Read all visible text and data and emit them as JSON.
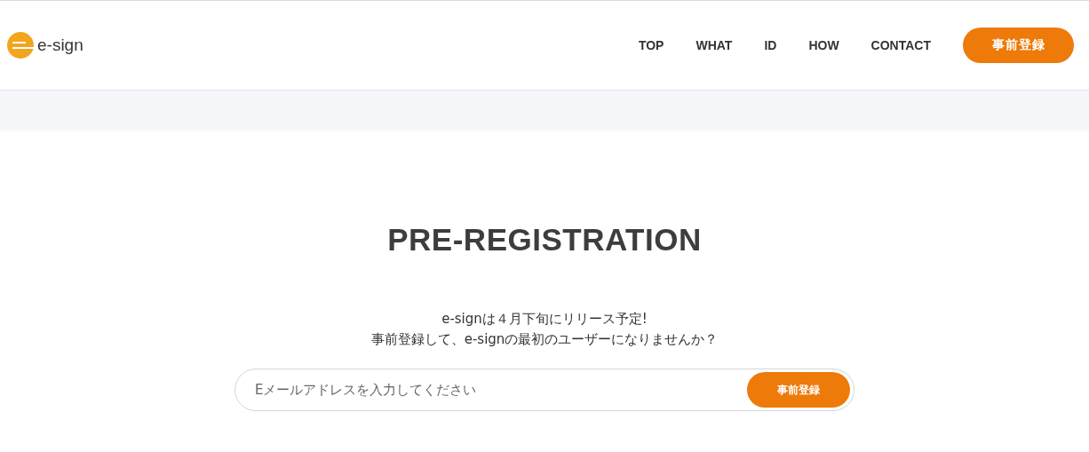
{
  "header": {
    "logo": "e-sign",
    "nav": [
      {
        "label": "TOP"
      },
      {
        "label": "WHAT"
      },
      {
        "label": "ID"
      },
      {
        "label": "HOW"
      },
      {
        "label": "CONTACT"
      }
    ],
    "cta": "事前登録"
  },
  "main": {
    "title": "PRE-REGISTRATION",
    "lines": [
      "e-signは４月下旬にリリース予定!",
      "事前登録して、e-signの最初のユーザーになりませんか？"
    ],
    "email": {
      "placeholder": "Eメールアドレスを入力してください"
    },
    "submit": "事前登録"
  }
}
